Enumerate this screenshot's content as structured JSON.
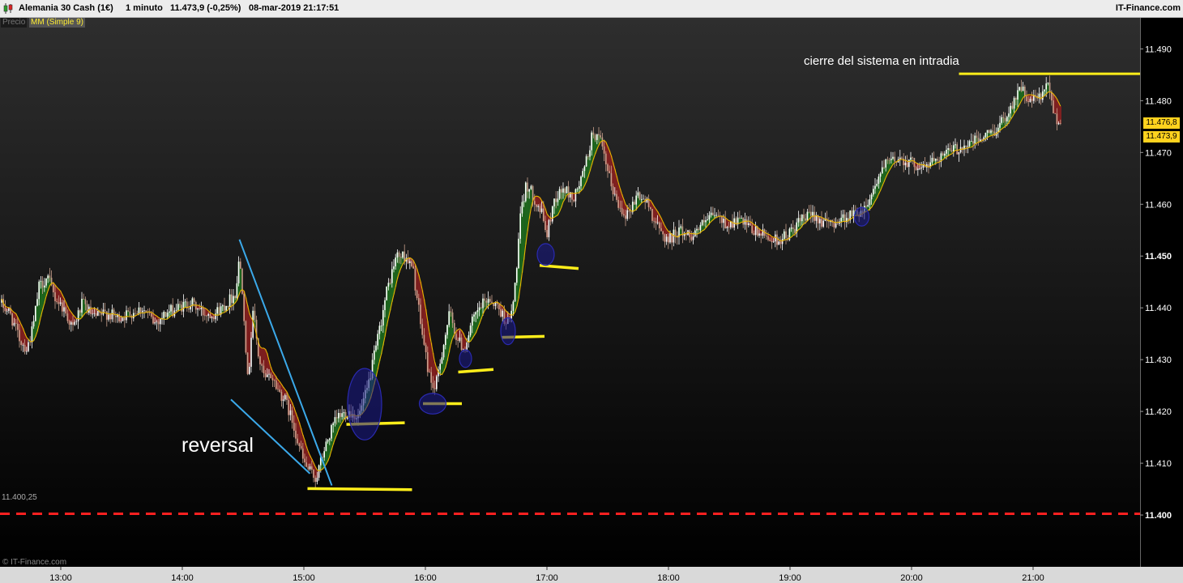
{
  "header": {
    "instrument": "Alemania 30 Cash (1€)",
    "timeframe": "1 minuto",
    "quote": "11.473,9 (-0,25%)",
    "datetime": "08-mar-2019 21:17:51",
    "brand": "IT-Finance.com"
  },
  "legend": {
    "price": "Precio",
    "ma": "MM (Simple 9)"
  },
  "colors": {
    "background_top": "#2e2e2e",
    "background_bottom": "#000000",
    "candle_up": "#ffffff",
    "candle_down": "#c8a08c",
    "ma_line": "#e8b400",
    "fill_up": "#1e6e1e",
    "fill_down": "#8b2020",
    "support_lines": "#ffee1a",
    "trend_lines": "#3ba9ea",
    "circles": "#1a1a8a",
    "reference_line": "#ff2020"
  },
  "annotations": {
    "reversal": "reversal",
    "system_close": "cierre del sistema en intradia",
    "reference_label": "11.400,25",
    "copyright": "© IT-Finance.com"
  },
  "last_prices": {
    "upper": "11.476,8",
    "lower": "11.473,9"
  },
  "chart_data": {
    "type": "line",
    "title": "Alemania 30 Cash (1€) 1 minuto",
    "xlabel": "",
    "ylabel": "",
    "ylim": [
      11390,
      11496
    ],
    "y_ticks": [
      {
        "value": 11490,
        "label": "11.490"
      },
      {
        "value": 11480,
        "label": "11.480"
      },
      {
        "value": 11470,
        "label": "11.470"
      },
      {
        "value": 11460,
        "label": "11.460"
      },
      {
        "value": 11450,
        "label": "11.450",
        "bold": true
      },
      {
        "value": 11440,
        "label": "11.440"
      },
      {
        "value": 11430,
        "label": "11.430"
      },
      {
        "value": 11420,
        "label": "11.420"
      },
      {
        "value": 11410,
        "label": "11.410"
      },
      {
        "value": 11400,
        "label": "11.400",
        "bold": true
      }
    ],
    "x_ticks": [
      {
        "t": 13.0,
        "label": "13:00"
      },
      {
        "t": 14.0,
        "label": "14:00"
      },
      {
        "t": 15.0,
        "label": "15:00"
      },
      {
        "t": 16.0,
        "label": "16:00"
      },
      {
        "t": 17.0,
        "label": "17:00"
      },
      {
        "t": 18.0,
        "label": "18:00"
      },
      {
        "t": 19.0,
        "label": "19:00"
      },
      {
        "t": 20.0,
        "label": "20:00"
      },
      {
        "t": 21.0,
        "label": "21:00"
      }
    ],
    "xlim": [
      12.5,
      21.88
    ],
    "grid": false,
    "series": [
      {
        "kind": "price_path",
        "points": [
          [
            12.5,
            11441
          ],
          [
            12.58,
            11439
          ],
          [
            12.66,
            11434
          ],
          [
            12.72,
            11432
          ],
          [
            12.77,
            11436
          ],
          [
            12.82,
            11444
          ],
          [
            12.89,
            11446
          ],
          [
            12.95,
            11442
          ],
          [
            13.02,
            11440
          ],
          [
            13.1,
            11436
          ],
          [
            13.18,
            11441
          ],
          [
            13.27,
            11438
          ],
          [
            13.37,
            11439
          ],
          [
            13.47,
            11438
          ],
          [
            13.57,
            11439
          ],
          [
            13.67,
            11440
          ],
          [
            13.77,
            11437
          ],
          [
            13.87,
            11439
          ],
          [
            13.97,
            11440
          ],
          [
            14.07,
            11441
          ],
          [
            14.17,
            11439
          ],
          [
            14.27,
            11439
          ],
          [
            14.37,
            11441
          ],
          [
            14.44,
            11443
          ],
          [
            14.47,
            11450
          ],
          [
            14.5,
            11442
          ],
          [
            14.54,
            11425
          ],
          [
            14.58,
            11440
          ],
          [
            14.63,
            11430
          ],
          [
            14.68,
            11426
          ],
          [
            14.73,
            11427
          ],
          [
            14.79,
            11424
          ],
          [
            14.85,
            11422
          ],
          [
            14.92,
            11417
          ],
          [
            15.0,
            11410
          ],
          [
            15.06,
            11408
          ],
          [
            15.1,
            11407
          ],
          [
            15.16,
            11412
          ],
          [
            15.22,
            11416
          ],
          [
            15.28,
            11419
          ],
          [
            15.37,
            11420
          ],
          [
            15.45,
            11419
          ],
          [
            15.52,
            11424
          ],
          [
            15.6,
            11433
          ],
          [
            15.68,
            11443
          ],
          [
            15.76,
            11450
          ],
          [
            15.84,
            11450
          ],
          [
            15.9,
            11447
          ],
          [
            15.96,
            11437
          ],
          [
            16.03,
            11427
          ],
          [
            16.08,
            11424
          ],
          [
            16.14,
            11432
          ],
          [
            16.2,
            11439
          ],
          [
            16.26,
            11434
          ],
          [
            16.32,
            11432
          ],
          [
            16.38,
            11437
          ],
          [
            16.45,
            11440
          ],
          [
            16.52,
            11442
          ],
          [
            16.6,
            11440
          ],
          [
            16.65,
            11438
          ],
          [
            16.69,
            11437
          ],
          [
            16.73,
            11442
          ],
          [
            16.78,
            11457
          ],
          [
            16.83,
            11464
          ],
          [
            16.9,
            11461
          ],
          [
            16.96,
            11458
          ],
          [
            17.0,
            11454
          ],
          [
            17.06,
            11461
          ],
          [
            17.14,
            11463
          ],
          [
            17.22,
            11461
          ],
          [
            17.3,
            11466
          ],
          [
            17.38,
            11474
          ],
          [
            17.44,
            11472
          ],
          [
            17.5,
            11466
          ],
          [
            17.58,
            11460
          ],
          [
            17.66,
            11458
          ],
          [
            17.75,
            11462
          ],
          [
            17.83,
            11460
          ],
          [
            17.92,
            11455
          ],
          [
            18.0,
            11453
          ],
          [
            18.08,
            11455
          ],
          [
            18.18,
            11454
          ],
          [
            18.28,
            11456
          ],
          [
            18.38,
            11458
          ],
          [
            18.48,
            11456
          ],
          [
            18.58,
            11457
          ],
          [
            18.68,
            11455
          ],
          [
            18.78,
            11454
          ],
          [
            18.88,
            11453
          ],
          [
            18.98,
            11454
          ],
          [
            19.1,
            11457
          ],
          [
            19.2,
            11458
          ],
          [
            19.3,
            11456
          ],
          [
            19.4,
            11457
          ],
          [
            19.5,
            11458
          ],
          [
            19.6,
            11459
          ],
          [
            19.67,
            11462
          ],
          [
            19.72,
            11465
          ],
          [
            19.8,
            11468
          ],
          [
            19.9,
            11469
          ],
          [
            20.0,
            11468
          ],
          [
            20.1,
            11467
          ],
          [
            20.2,
            11469
          ],
          [
            20.3,
            11470
          ],
          [
            20.4,
            11471
          ],
          [
            20.5,
            11472
          ],
          [
            20.6,
            11473
          ],
          [
            20.72,
            11475
          ],
          [
            20.82,
            11479
          ],
          [
            20.9,
            11483
          ],
          [
            20.94,
            11480
          ],
          [
            21.0,
            11480
          ],
          [
            21.08,
            11481
          ],
          [
            21.12,
            11483
          ],
          [
            21.18,
            11477
          ],
          [
            21.24,
            11475
          ]
        ]
      }
    ],
    "overlays": {
      "reference_level": 11400.25,
      "system_close_level": 11485.2,
      "trend_lines": [
        {
          "from": [
            14.47,
            11453.2
          ],
          "to": [
            15.23,
            11405.7
          ]
        },
        {
          "from": [
            14.4,
            11422.3
          ],
          "to": [
            15.05,
            11408.0
          ]
        }
      ],
      "support_lines": [
        {
          "from": [
            15.03,
            11405.1
          ],
          "to": [
            15.89,
            11404.9
          ]
        },
        {
          "from": [
            15.35,
            11417.5
          ],
          "to": [
            15.83,
            11417.8
          ]
        },
        {
          "from": [
            15.98,
            11421.5
          ],
          "to": [
            16.3,
            11421.5
          ]
        },
        {
          "from": [
            16.27,
            11427.6
          ],
          "to": [
            16.56,
            11428.1
          ]
        },
        {
          "from": [
            16.63,
            11434.3
          ],
          "to": [
            16.98,
            11434.5
          ]
        },
        {
          "from": [
            16.94,
            11448.2
          ],
          "to": [
            17.26,
            11447.6
          ]
        }
      ],
      "circles": [
        {
          "t": 15.5,
          "v": 11421.4,
          "rt": 0.14,
          "rv": 6.9
        },
        {
          "t": 16.06,
          "v": 11421.5,
          "rt": 0.11,
          "rv": 2.0
        },
        {
          "t": 16.33,
          "v": 11430.2,
          "rt": 0.05,
          "rv": 1.7
        },
        {
          "t": 16.68,
          "v": 11435.5,
          "rt": 0.06,
          "rv": 2.6
        },
        {
          "t": 16.99,
          "v": 11450.3,
          "rt": 0.07,
          "rv": 2.1
        },
        {
          "t": 19.59,
          "v": 11457.6,
          "rt": 0.06,
          "rv": 1.8
        }
      ]
    }
  }
}
